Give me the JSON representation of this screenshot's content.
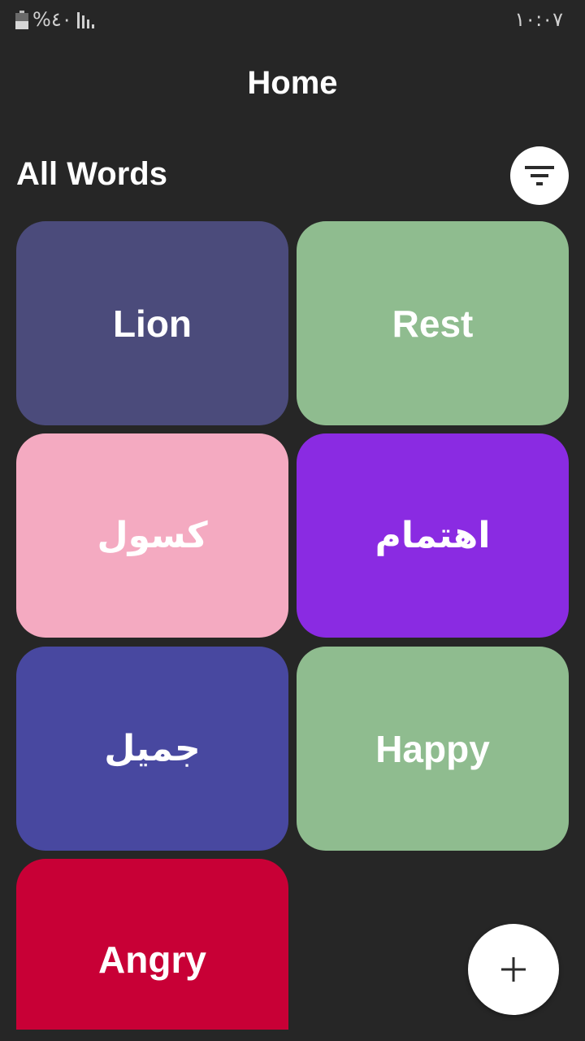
{
  "status_bar": {
    "battery_percent": "%٤٠",
    "time": "١٠:٠٧",
    "battery_icon": "battery-icon",
    "signal_icon": "signal-icon"
  },
  "header": {
    "title": "Home"
  },
  "section": {
    "title": "All Words",
    "filter_icon": "filter-icon"
  },
  "words": [
    {
      "label": "Lion",
      "color": "#4b4b7b"
    },
    {
      "label": "Rest",
      "color": "#8fbc8f"
    },
    {
      "label": "كسول",
      "color": "#f4aac1"
    },
    {
      "label": "اهتمام",
      "color": "#8a2be2"
    },
    {
      "label": "جميل",
      "color": "#4848a0"
    },
    {
      "label": "Happy",
      "color": "#8fbc8f"
    },
    {
      "label": "Angry",
      "color": "#c80036"
    }
  ],
  "fab": {
    "icon": "plus-icon"
  }
}
